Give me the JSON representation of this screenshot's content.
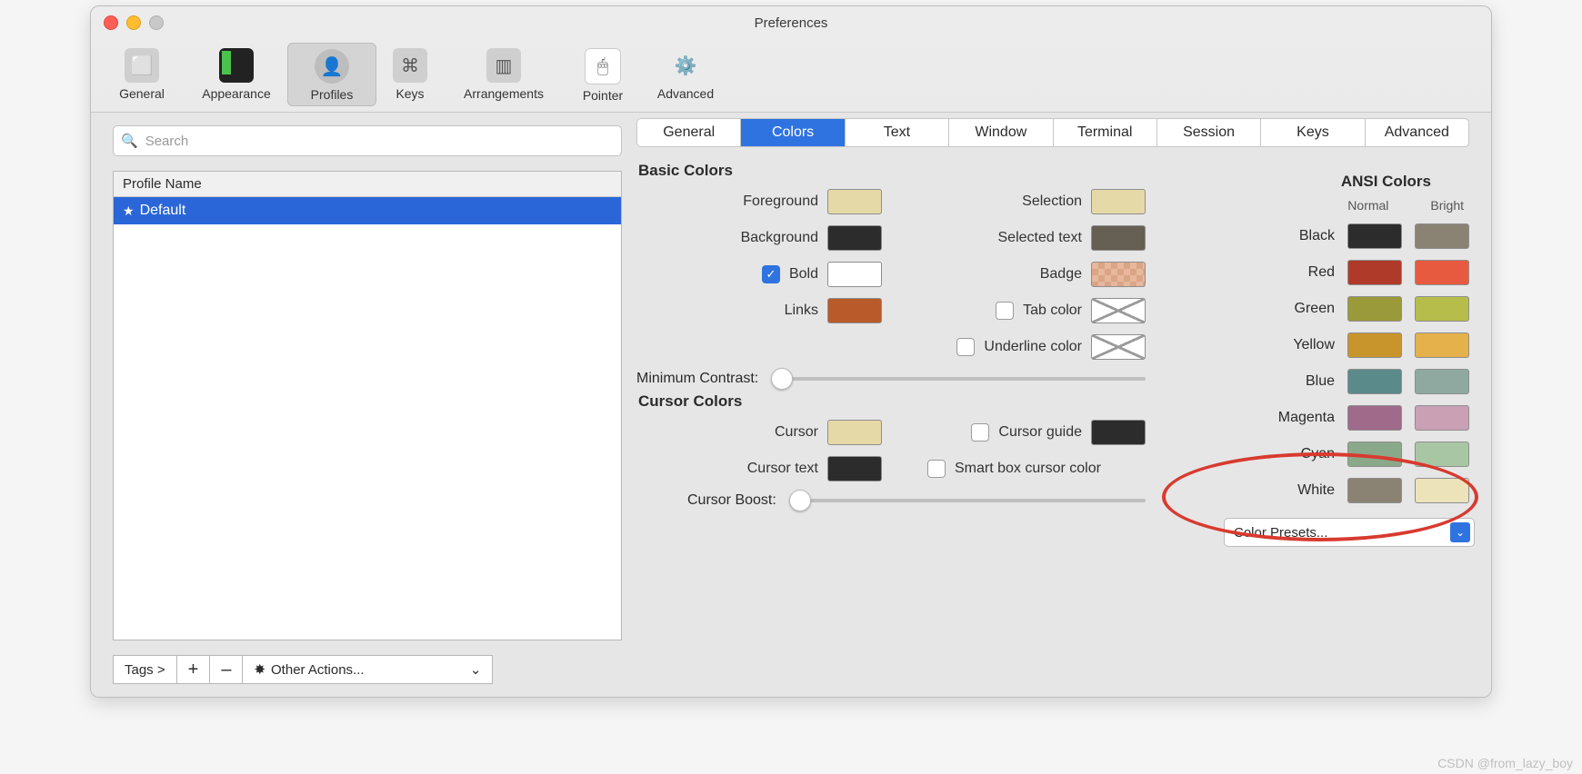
{
  "window": {
    "title": "Preferences"
  },
  "toolbar": {
    "items": [
      {
        "label": "General"
      },
      {
        "label": "Appearance"
      },
      {
        "label": "Profiles"
      },
      {
        "label": "Keys"
      },
      {
        "label": "Arrangements"
      },
      {
        "label": "Pointer"
      },
      {
        "label": "Advanced"
      }
    ],
    "selected": "Profiles"
  },
  "search": {
    "placeholder": "Search"
  },
  "profile_list": {
    "header": "Profile Name",
    "items": [
      {
        "name": "Default",
        "starred": true,
        "selected": true
      }
    ]
  },
  "bottom_bar": {
    "tags": "Tags >",
    "add": "+",
    "remove": "–",
    "other_actions": "Other Actions..."
  },
  "subtabs": {
    "items": [
      "General",
      "Colors",
      "Text",
      "Window",
      "Terminal",
      "Session",
      "Keys",
      "Advanced"
    ],
    "active": "Colors"
  },
  "basic_colors": {
    "title": "Basic Colors",
    "foreground": {
      "label": "Foreground",
      "color": "#e6d9a8"
    },
    "background": {
      "label": "Background",
      "color": "#2c2c2c"
    },
    "bold": {
      "label": "Bold",
      "checked": true,
      "color": "#ffffff"
    },
    "links": {
      "label": "Links",
      "color": "#b85a2a"
    },
    "selection": {
      "label": "Selection",
      "color": "#e6d9a8"
    },
    "selected_text": {
      "label": "Selected text",
      "color": "#665f54"
    },
    "badge": {
      "label": "Badge",
      "checker": true
    },
    "tab_color": {
      "label": "Tab color",
      "checked": false,
      "disabled_swatch": true
    },
    "underline": {
      "label": "Underline color",
      "checked": false,
      "disabled_swatch": true
    },
    "min_contrast": {
      "label": "Minimum Contrast:",
      "value": 0
    }
  },
  "cursor_colors": {
    "title": "Cursor Colors",
    "cursor": {
      "label": "Cursor",
      "color": "#e6d9a8"
    },
    "cursor_text": {
      "label": "Cursor text",
      "color": "#2c2c2c"
    },
    "cursor_guide": {
      "label": "Cursor guide",
      "checked": false,
      "color": "#2c2c2c"
    },
    "smart_box": {
      "label": "Smart box cursor color",
      "checked": false
    },
    "cursor_boost": {
      "label": "Cursor Boost:",
      "value": 0
    }
  },
  "ansi": {
    "title": "ANSI Colors",
    "normal_label": "Normal",
    "bright_label": "Bright",
    "rows": [
      {
        "name": "Black",
        "normal": "#2c2c2c",
        "bright": "#8a8374"
      },
      {
        "name": "Red",
        "normal": "#b03a2a",
        "bright": "#e85a3f"
      },
      {
        "name": "Green",
        "normal": "#9a9a3a",
        "bright": "#b6bd4a"
      },
      {
        "name": "Yellow",
        "normal": "#c8952d",
        "bright": "#e4b14a"
      },
      {
        "name": "Blue",
        "normal": "#5b8a8a",
        "bright": "#8fa8a0"
      },
      {
        "name": "Magenta",
        "normal": "#a06a8a",
        "bright": "#caa0b5"
      },
      {
        "name": "Cyan",
        "normal": "#8aa88a",
        "bright": "#a9c6a4"
      },
      {
        "name": "White",
        "normal": "#8a8374",
        "bright": "#ece3bb"
      }
    ],
    "presets_label": "Color Presets..."
  },
  "watermark": "CSDN @from_lazy_boy"
}
